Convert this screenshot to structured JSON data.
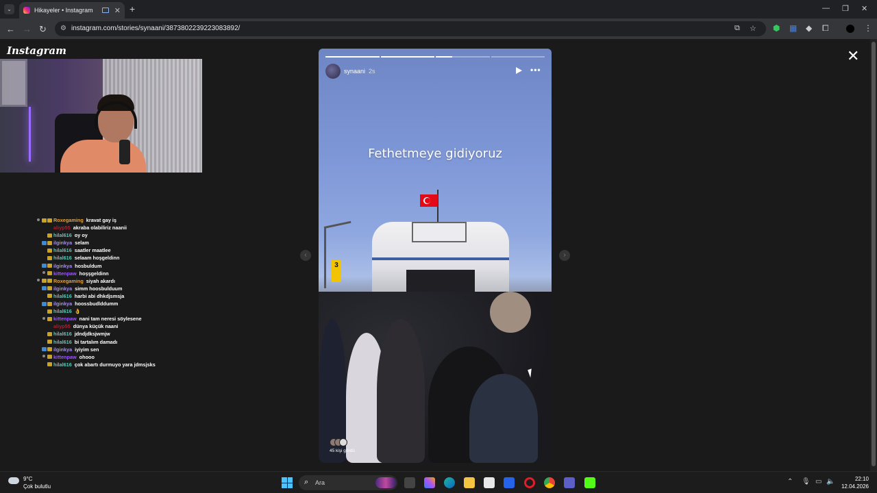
{
  "browser": {
    "tab_title": "Hikayeler • Instagram",
    "url": "instagram.com/stories/synaani/3873802239223083892/",
    "minimize": "—",
    "restore": "❐",
    "close": "✕"
  },
  "page": {
    "logo": "Instagram",
    "close_label": "✕"
  },
  "chat": [
    {
      "user": "Roxegaming",
      "text": "kravat gay iş",
      "color": "#e6a23c",
      "badges": [
        "dot",
        "gold",
        "gold"
      ]
    },
    {
      "user": "aliyp55",
      "text": "akraba olabiliriz naanii",
      "color": "#c0142e",
      "badges": []
    },
    {
      "user": "hilal616",
      "text": "oy oy",
      "color": "#4ad3c0",
      "badges": [
        "gold"
      ]
    },
    {
      "user": "ilginkya",
      "text": "selam",
      "color": "#a78bfa",
      "badges": [
        "blue",
        "gold"
      ]
    },
    {
      "user": "hilal616",
      "text": "saatler maatlee",
      "color": "#4ad3c0",
      "badges": [
        "gold"
      ]
    },
    {
      "user": "hilal616",
      "text": "selaam hoşgeldinn",
      "color": "#4ad3c0",
      "badges": [
        "gold"
      ]
    },
    {
      "user": "ilginkya",
      "text": "hosbuldum",
      "color": "#a78bfa",
      "badges": [
        "blue",
        "gold"
      ]
    },
    {
      "user": "kittenpaw",
      "text": "hoşşgeldinn",
      "color": "#9b59f6",
      "badges": [
        "dot",
        "gold"
      ]
    },
    {
      "user": "Roxegaming",
      "text": "siyah akardı",
      "color": "#e6a23c",
      "badges": [
        "dot",
        "gold",
        "gold"
      ]
    },
    {
      "user": "ilginkya",
      "text": "simm hoosbulduum",
      "color": "#a78bfa",
      "badges": [
        "blue",
        "gold"
      ]
    },
    {
      "user": "hilal616",
      "text": "harbi abi dhkdjsmsja",
      "color": "#4ad3c0",
      "badges": [
        "gold"
      ]
    },
    {
      "user": "ilginkya",
      "text": "hoossbudlddumm",
      "color": "#a78bfa",
      "badges": [
        "blue",
        "gold"
      ]
    },
    {
      "user": "hilal616",
      "text": "👌",
      "color": "#4ad3c0",
      "badges": [
        "gold"
      ]
    },
    {
      "user": "kittenpaw",
      "text": "nani tam neresi söylesene",
      "color": "#9b59f6",
      "badges": [
        "dot",
        "gold"
      ]
    },
    {
      "user": "aliyp55",
      "text": "dünya küçük naani",
      "color": "#c0142e",
      "badges": []
    },
    {
      "user": "hilal616",
      "text": "jdndjdksjwmjw",
      "color": "#4ad3c0",
      "badges": [
        "gold"
      ]
    },
    {
      "user": "hilal616",
      "text": "bi tartalım damadı",
      "color": "#4ad3c0",
      "badges": [
        "gold"
      ]
    },
    {
      "user": "ilginkya",
      "text": "iyiyim sen",
      "color": "#a78bfa",
      "badges": [
        "blue",
        "gold"
      ]
    },
    {
      "user": "kittenpaw",
      "text": "ohooo",
      "color": "#9b59f6",
      "badges": [
        "dot",
        "gold"
      ]
    },
    {
      "user": "hilal616",
      "text": "çok abartı durmuyo yara jdmsjsks",
      "color": "#4ad3c0",
      "badges": [
        "gold"
      ]
    }
  ],
  "story": {
    "username": "synaani",
    "time_ago": "2s",
    "caption": "Fethetmeye gidiyoruz",
    "progress": [
      1,
      1,
      0.3,
      0
    ],
    "viewers_text": "45 kişi gördü",
    "sign_number": "3"
  },
  "taskbar": {
    "temperature": "9°C",
    "condition": "Çok bulutlu",
    "search_placeholder": "Ara",
    "time": "22:10",
    "date": "12.04.2026"
  }
}
